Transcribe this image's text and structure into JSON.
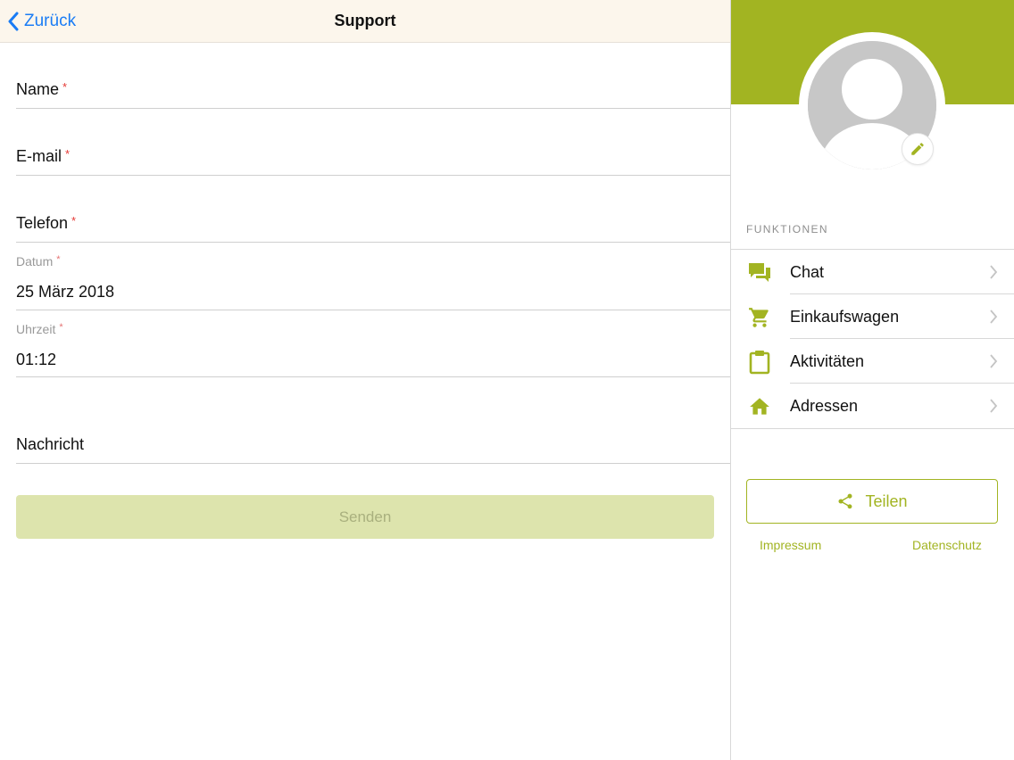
{
  "navbar": {
    "back_label": "Zurück",
    "title": "Support"
  },
  "form": {
    "name_label": "Name",
    "email_label": "E-mail",
    "phone_label": "Telefon",
    "date_label": "Datum",
    "date_value": "25 März 2018",
    "time_label": "Uhrzeit",
    "time_value": "01:12",
    "message_label": "Nachricht",
    "required_mark": "*",
    "send_label": "Senden"
  },
  "sidebar": {
    "section_title": "FUNKTIONEN",
    "items": [
      {
        "label": "Chat",
        "icon": "chat-icon"
      },
      {
        "label": "Einkaufswagen",
        "icon": "cart-icon"
      },
      {
        "label": "Aktivitäten",
        "icon": "clipboard-icon"
      },
      {
        "label": "Adressen",
        "icon": "home-icon"
      }
    ],
    "share_label": "Teilen",
    "impressum_label": "Impressum",
    "datenschutz_label": "Datenschutz"
  },
  "colors": {
    "accent": "#a2b422",
    "link_blue": "#1a7cf5",
    "navbar_bg": "#fcf6ec",
    "disabled_button": "#dde4ad",
    "required": "#e53935"
  }
}
